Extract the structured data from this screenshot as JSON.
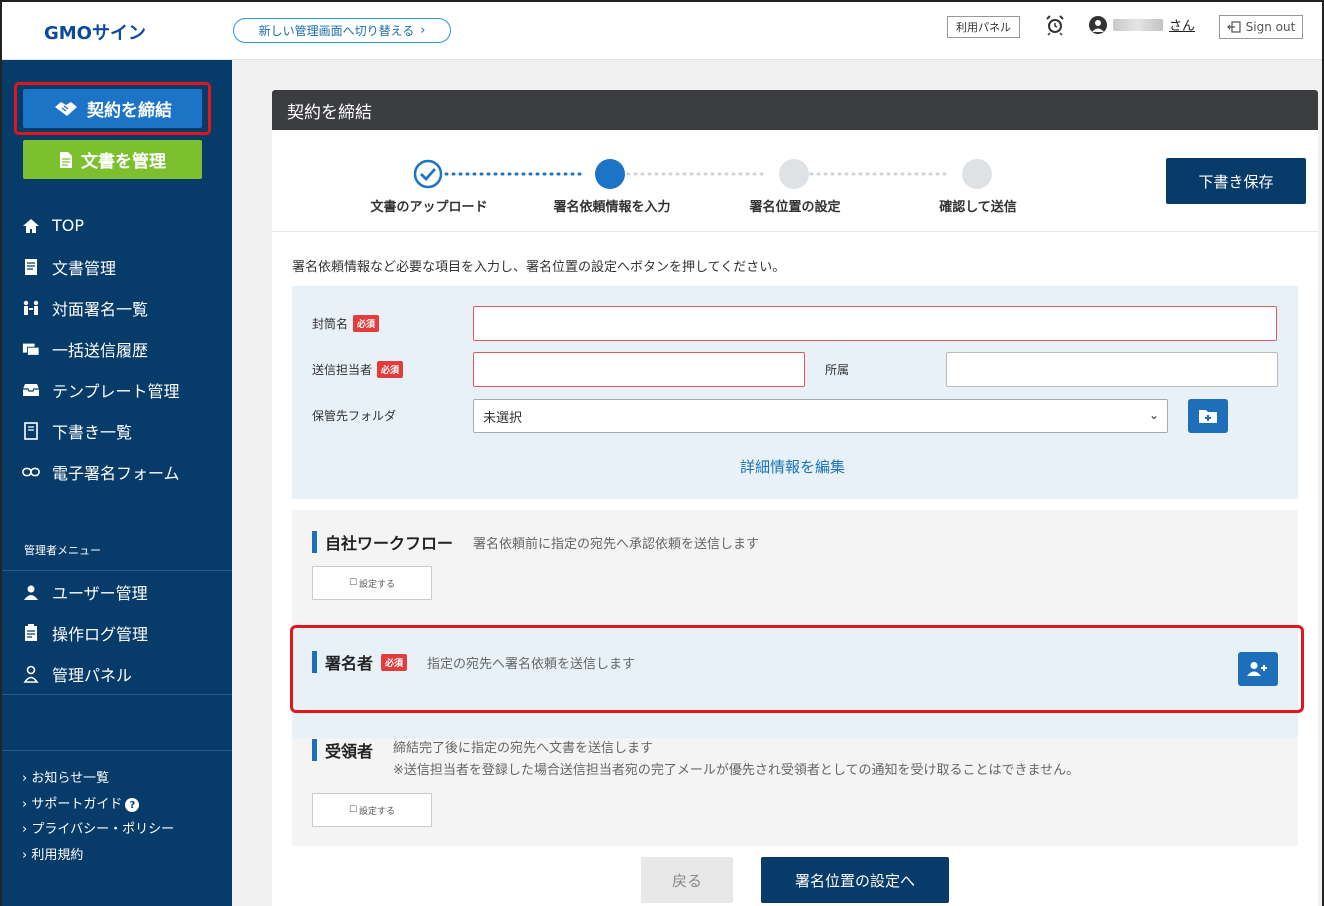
{
  "header": {
    "logo": "GMOサイン",
    "switch_label": "新しい管理画面へ切り替える",
    "switch_chevron": "›",
    "panel_label": "利用パネル",
    "user_suffix": "さん",
    "signout_label": "Sign out"
  },
  "sidebar": {
    "contract_btn": "契約を締結",
    "docs_btn": "文書を管理",
    "nav": [
      {
        "label": "TOP",
        "icon": "home-icon"
      },
      {
        "label": "文書管理",
        "icon": "document-icon"
      },
      {
        "label": "対面署名一覧",
        "icon": "face-to-face-icon"
      },
      {
        "label": "一括送信履歴",
        "icon": "bulk-send-icon"
      },
      {
        "label": "テンプレート管理",
        "icon": "template-icon"
      },
      {
        "label": "下書き一覧",
        "icon": "draft-icon"
      },
      {
        "label": "電子署名フォーム",
        "icon": "link-icon"
      }
    ],
    "admin_label": "管理者メニュー",
    "admin_nav": [
      {
        "label": "ユーザー管理",
        "icon": "user-icon"
      },
      {
        "label": "操作ログ管理",
        "icon": "log-icon"
      },
      {
        "label": "管理パネル",
        "icon": "admin-user-icon"
      }
    ],
    "footer": [
      "お知らせ一覧",
      "サポートガイド",
      "プライバシー・ポリシー",
      "利用規約"
    ],
    "footer_prefix": "›",
    "help_glyph": "?"
  },
  "main": {
    "title": "契約を締結",
    "steps": [
      {
        "label": "文書のアップロード",
        "state": "done"
      },
      {
        "label": "署名依頼情報を入力",
        "state": "current"
      },
      {
        "label": "署名位置の設定",
        "state": "pending"
      },
      {
        "label": "確認して送信",
        "state": "pending"
      }
    ],
    "save_draft": "下書き保存",
    "intro": "署名依頼情報など必要な項目を入力し、署名位置の設定へボタンを押してください。",
    "form": {
      "envelope_label": "封筒名",
      "required": "必須",
      "sender_label": "送信担当者",
      "dept_label": "所属",
      "folder_label": "保管先フォルダ",
      "folder_value": "未選択",
      "select_arrow": "⌄",
      "edit_detail": "詳細情報を編集"
    },
    "workflow": {
      "title": "自社ワークフロー",
      "desc": "署名依頼前に指定の宛先へ承認依頼を送信します",
      "set_label": "設定する",
      "checkbox_glyph": "☐"
    },
    "signer": {
      "title": "署名者",
      "desc": "指定の宛先へ署名依頼を送信します"
    },
    "recipient": {
      "title": "受領者",
      "desc1": "締結完了後に指定の宛先へ文書を送信します",
      "desc2": "※送信担当者を登録した場合送信担当者宛の完了メールが優先され受領者としての通知を受け取ることはできません。",
      "set_label": "設定する"
    },
    "back": "戻る",
    "next": "署名位置の設定へ"
  },
  "colors": {
    "sidebar": "#063b6a",
    "primary": "#1b74c5",
    "docs_green": "#7cc030",
    "highlight": "#e0161a",
    "required": "#e23c3c"
  }
}
